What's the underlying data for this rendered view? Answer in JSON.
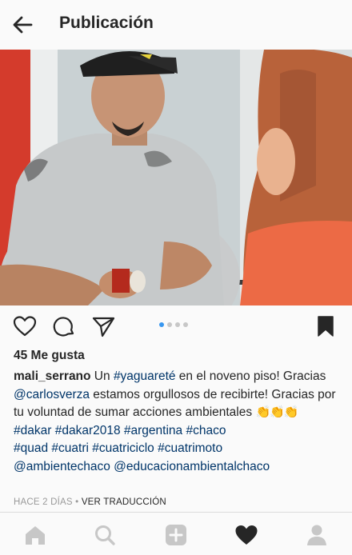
{
  "header": {
    "title": "Publicación"
  },
  "post": {
    "likes": "45 Me gusta",
    "username": "mali_serrano",
    "caption": {
      "t1": " Un ",
      "tag_yaguarete": "#yaguareté",
      "t2": " en el noveno piso! Gracias ",
      "mention_carlos": "@carlosverza",
      "t3": " estamos orgullosos de recibirte! Gracias por tu voluntad de sumar acciones ambientales ",
      "emoji": "👏👏👏",
      "hashtags": [
        "#dakar",
        "#dakar2018",
        "#argentina",
        "#chaco",
        "#quad",
        "#cuatri",
        "#cuatriciclo",
        "#cuatrimoto"
      ],
      "mentions": [
        "@ambientechaco",
        "@educacionambientalchaco"
      ]
    },
    "time": "HACE 2 DÍAS",
    "separator": " • ",
    "translate": "VER TRADUCCIÓN",
    "carousel": {
      "count": 4,
      "active": 0
    }
  },
  "icons": {
    "back": "arrow-left-icon",
    "like": "heart-outline-icon",
    "comment": "comment-bubble-icon",
    "share": "paper-plane-icon",
    "save": "bookmark-filled-icon",
    "nav": [
      "home-icon",
      "search-icon",
      "add-post-icon",
      "activity-heart-icon",
      "profile-icon"
    ]
  },
  "colors": {
    "link": "#003569",
    "carousel_active": "#3897f0",
    "muted": "#999999"
  }
}
